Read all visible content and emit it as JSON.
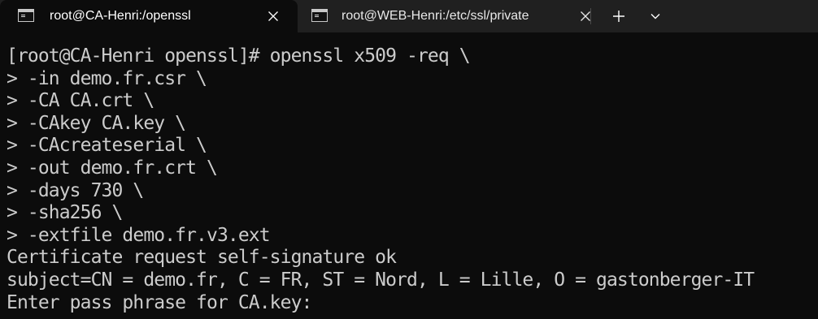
{
  "tabs": [
    {
      "title": "root@CA-Henri:/openssl",
      "active": true
    },
    {
      "title": "root@WEB-Henri:/etc/ssl/private",
      "active": false
    }
  ],
  "toolbar": {
    "new_tab_icon": "plus-icon",
    "dropdown_icon": "chevron-down-icon"
  },
  "colors": {
    "terminal_bg": "#0c0c0c",
    "terminal_fg": "#cccccc",
    "tabbar_bg": "#202020"
  },
  "terminal": {
    "lines": [
      "[root@CA-Henri openssl]# openssl x509 -req \\",
      "> -in demo.fr.csr \\",
      "> -CA CA.crt \\",
      "> -CAkey CA.key \\",
      "> -CAcreateserial \\",
      "> -out demo.fr.crt \\",
      "> -days 730 \\",
      "> -sha256 \\",
      "> -extfile demo.fr.v3.ext",
      "Certificate request self-signature ok",
      "subject=CN = demo.fr, C = FR, ST = Nord, L = Lille, O = gastonberger-IT",
      "Enter pass phrase for CA.key:"
    ]
  }
}
